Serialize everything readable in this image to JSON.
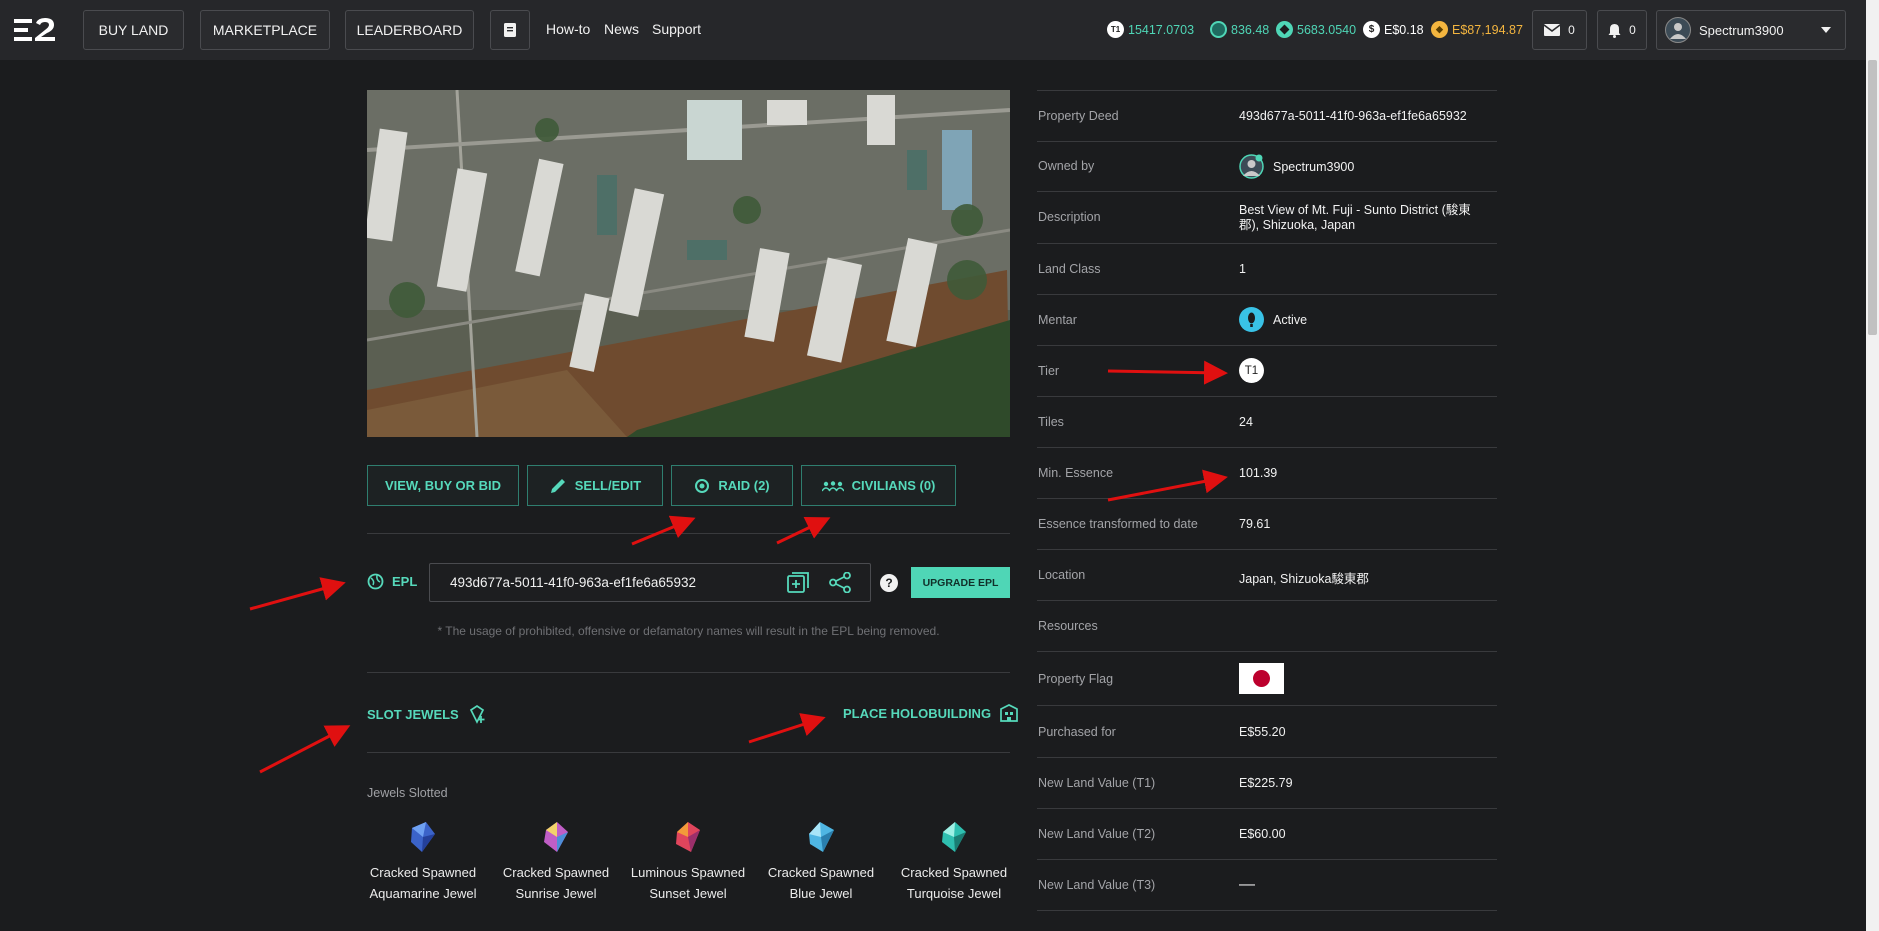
{
  "nav": {
    "buy_land": "BUY LAND",
    "marketplace": "MARKETPLACE",
    "leaderboard": "LEADERBOARD",
    "howto": "How-to",
    "news": "News",
    "support": "Support"
  },
  "currencies": [
    {
      "icon": "t1-token-icon",
      "value": "15417.0703",
      "color": "#4fd6b6"
    },
    {
      "icon": "essence-icon",
      "value": "836.48",
      "color": "#4fd6b6"
    },
    {
      "icon": "gem-icon",
      "value": "5683.0540",
      "color": "#4fd6b6"
    },
    {
      "icon": "dollar-icon",
      "value": "E$0.18",
      "color": "#ffffff"
    },
    {
      "icon": "gold-coin-icon",
      "value": "E$87,194.87",
      "color": "#f3b53f"
    }
  ],
  "inbox": {
    "count": "0"
  },
  "notifications": {
    "count": "0"
  },
  "user": {
    "name": "Spectrum3900"
  },
  "actions": {
    "view": "VIEW, BUY OR BID",
    "sell": "SELL/EDIT",
    "raid": "RAID (2)",
    "civilians": "CIVILIANS (0)"
  },
  "epl": {
    "label": "EPL",
    "value": "493d677a-5011-41f0-963a-ef1fe6a65932",
    "upgrade": "UPGRADE EPL",
    "help": "?",
    "note": "* The usage of prohibited, offensive or defamatory names will result in the EPL being removed."
  },
  "slot_jewels": "SLOT JEWELS",
  "place_holobuilding": "PLACE HOLOBUILDING",
  "jewels_slotted_title": "Jewels Slotted",
  "jewels": [
    {
      "line1": "Cracked Spawned",
      "line2": "Aquamarine Jewel",
      "color": "#3b63c9"
    },
    {
      "line1": "Cracked Spawned",
      "line2": "Sunrise Jewel",
      "color": "#c05ec6"
    },
    {
      "line1": "Luminous Spawned",
      "line2": "Sunset Jewel",
      "color": "#e0455c"
    },
    {
      "line1": "Cracked Spawned",
      "line2": "Blue Jewel",
      "color": "#4fb6e3"
    },
    {
      "line1": "Cracked Spawned",
      "line2": "Turquoise Jewel",
      "color": "#2fbfb0"
    }
  ],
  "property": {
    "deed_label": "Property Deed",
    "deed": "493d677a-5011-41f0-963a-ef1fe6a65932",
    "owned_label": "Owned by",
    "owner": "Spectrum3900",
    "desc_label": "Description",
    "desc_line1": "Best View of Mt. Fuji - Sunto District (駿東",
    "desc_line2": "郡), Shizuoka, Japan",
    "class_label": "Land Class",
    "class": "1",
    "mentar_label": "Mentar",
    "mentar": "Active",
    "tier_label": "Tier",
    "tier": "T1",
    "tiles_label": "Tiles",
    "tiles": "24",
    "min_essence_label": "Min. Essence",
    "min_essence": "101.39",
    "essence_label": "Essence transformed to date",
    "essence": "79.61",
    "location_label": "Location",
    "location": "Japan, Shizuoka駿東郡",
    "resources_label": "Resources",
    "flag_label": "Property Flag",
    "purchased_label": "Purchased for",
    "purchased": "E$55.20",
    "t1_label": "New Land Value (T1)",
    "t1": "E$225.79",
    "t2_label": "New Land Value (T2)",
    "t2": "E$60.00",
    "t3_label": "New Land Value (T3)",
    "t3": "—"
  }
}
